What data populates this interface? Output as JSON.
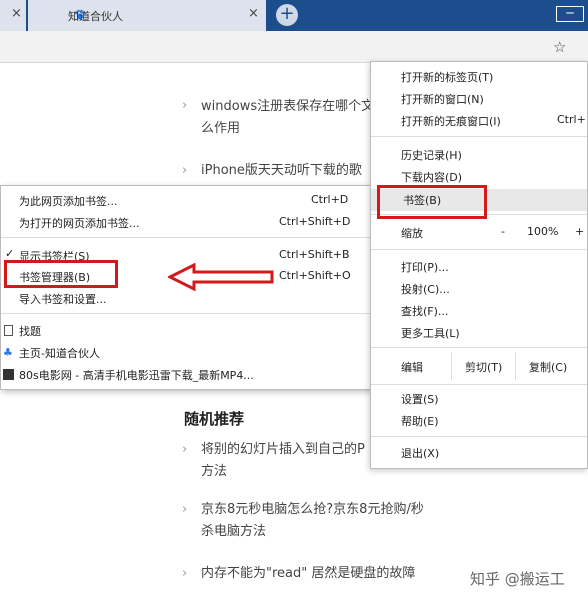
{
  "tabs": [
    {
      "label": "",
      "close": "×"
    },
    {
      "label": "知道合伙人",
      "close": "×"
    }
  ],
  "new_tab": "+",
  "window_minimize": "─",
  "toolbar": {
    "star": "☆"
  },
  "articles": [
    {
      "line1": "windows注册表保存在哪个文",
      "line2": "么作用"
    },
    {
      "line1": "iPhone版天天动听下载的歌",
      "line2": ""
    },
    {
      "line1": "将别的幻灯片插入到自己的P",
      "line2": "方法"
    },
    {
      "line1": "京东8元秒电脑怎么抢?京东8元抢购/秒",
      "line2": "杀电脑方法"
    },
    {
      "line1": "内存不能为\"read\" 居然是硬盘的故障",
      "line2": ""
    }
  ],
  "section_title": "随机推荐",
  "watermark": "知乎 @搬运工",
  "bookmark_menu": {
    "items": [
      {
        "label": "为此网页添加书签...",
        "shortcut": "Ctrl+D"
      },
      {
        "label": "为打开的网页添加书签...",
        "shortcut": "Ctrl+Shift+D"
      },
      {
        "label": "显示书签栏(S)",
        "shortcut": "Ctrl+Shift+B",
        "checked": "✓"
      },
      {
        "label": "书签管理器(B)",
        "shortcut": "Ctrl+Shift+O"
      },
      {
        "label": "导入书签和设置...",
        "shortcut": ""
      },
      {
        "label": "找题",
        "shortcut": ""
      },
      {
        "label": "主页-知道合伙人",
        "shortcut": ""
      },
      {
        "label": "80s电影网 - 高清手机电影迅雷下载_最新MP4...",
        "shortcut": ""
      }
    ]
  },
  "main_menu": {
    "new_tab": {
      "label": "打开新的标签页(T)",
      "shortcut": ""
    },
    "new_window": {
      "label": "打开新的窗口(N)",
      "shortcut": ""
    },
    "incognito": {
      "label": "打开新的无痕窗口(I)",
      "shortcut": "Ctrl+"
    },
    "history": {
      "label": "历史记录(H)"
    },
    "downloads": {
      "label": "下载内容(D)"
    },
    "bookmarks": {
      "label": "书签(B)"
    },
    "zoom": {
      "label": "缩放",
      "minus": "-",
      "value": "100%",
      "plus": "+"
    },
    "print": {
      "label": "打印(P)..."
    },
    "cast": {
      "label": "投射(C)..."
    },
    "find": {
      "label": "查找(F)..."
    },
    "more_tools": {
      "label": "更多工具(L)"
    },
    "edit": {
      "label": "编辑",
      "cut": "剪切(T)",
      "copy": "复制(C)"
    },
    "settings": {
      "label": "设置(S)"
    },
    "help": {
      "label": "帮助(E)"
    },
    "exit": {
      "label": "退出(X)"
    }
  },
  "colors": {
    "annotation_red": "#d21a1a",
    "tab_bar": "#1c4e8d"
  }
}
